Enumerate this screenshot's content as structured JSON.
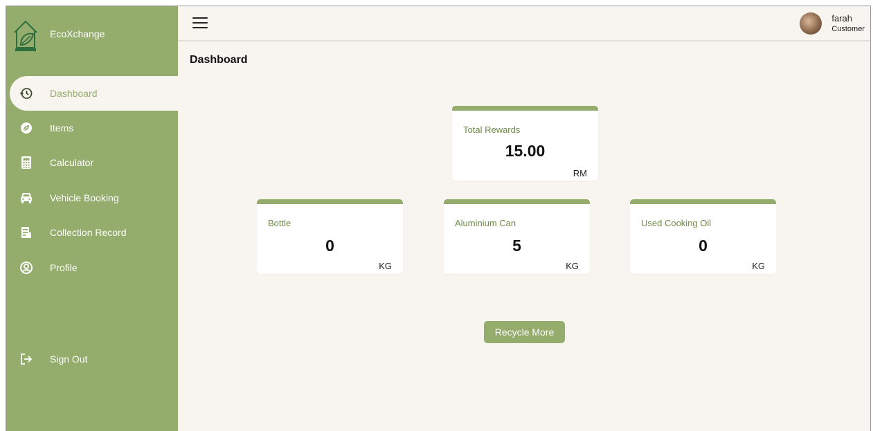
{
  "brand": {
    "name": "EcoXchange",
    "logo_text": "EcoXchange"
  },
  "topbar": {
    "user_name": "farah",
    "user_role": "Customer"
  },
  "sidebar": {
    "items": [
      {
        "label": "Dashboard",
        "icon": "dashboard-history-icon",
        "active": true
      },
      {
        "label": "Items",
        "icon": "leaf-icon"
      },
      {
        "label": "Calculator",
        "icon": "calculator-icon"
      },
      {
        "label": "Vehicle Booking",
        "icon": "car-icon"
      },
      {
        "label": "Collection Record",
        "icon": "record-icon"
      },
      {
        "label": "Profile",
        "icon": "profile-icon"
      }
    ],
    "sign_out": {
      "label": "Sign Out",
      "icon": "sign-out-icon"
    }
  },
  "main": {
    "title": "Dashboard",
    "rewards": {
      "label": "Total Rewards",
      "value": "15.00",
      "unit": "RM"
    },
    "cards": [
      {
        "label": "Bottle",
        "value": "0",
        "unit": "KG"
      },
      {
        "label": "Aluminium Can",
        "value": "5",
        "unit": "KG"
      },
      {
        "label": "Used Cooking Oil",
        "value": "0",
        "unit": "KG"
      }
    ],
    "recycle_button": "Recycle More"
  },
  "colors": {
    "accent": "#94ac6c",
    "background": "#f8f4f0",
    "label_green": "#6f8a45"
  }
}
